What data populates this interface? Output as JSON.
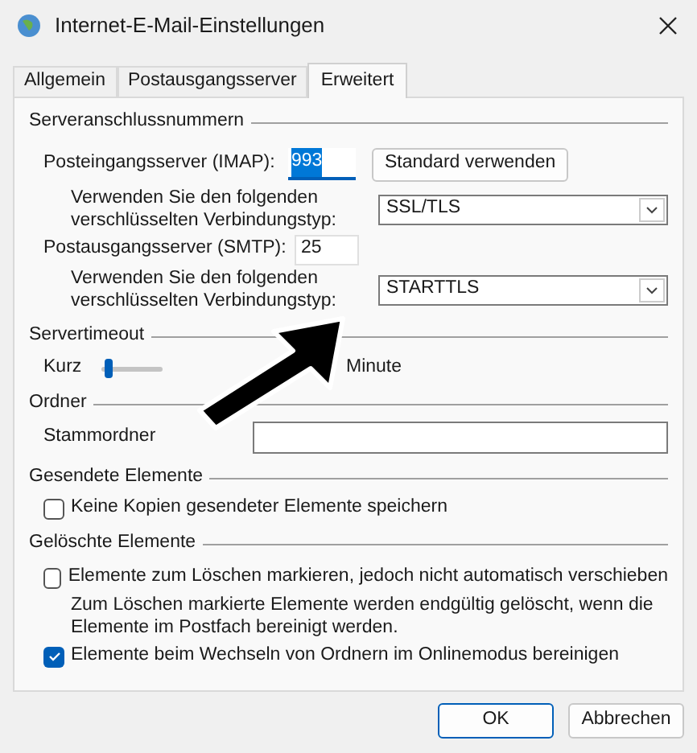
{
  "window": {
    "title": "Internet-E-Mail-Einstellungen"
  },
  "tabs": [
    {
      "label": "Allgemein",
      "selected": false
    },
    {
      "label": "Postausgangsserver",
      "selected": false
    },
    {
      "label": "Erweitert",
      "selected": true
    }
  ],
  "ports": {
    "title": "Serveranschlussnummern",
    "incoming": {
      "label": "Posteingangsserver (IMAP):",
      "value": "993",
      "selected": true,
      "button": "Standard verwenden"
    },
    "incoming_encryption": {
      "label": "Verwenden Sie den folgenden verschlüsselten Verbindungstyp:",
      "value": "SSL/TLS"
    },
    "outgoing": {
      "label": "Postausgangsserver (SMTP):",
      "value": "25",
      "selected": false
    },
    "outgoing_encryption": {
      "label": "Verwenden Sie den folgenden verschlüsselten Verbindungstyp:",
      "value": "STARTTLS"
    }
  },
  "timeout": {
    "title": "Servertimeout",
    "min_label": "Kurz",
    "level": 0.05,
    "reading": "Minute"
  },
  "folders": {
    "title": "Ordner",
    "label": "Stammordner"
  },
  "sent": {
    "title": "Gesendete Elemente",
    "options": [
      {
        "label": "Keine Kopien gesendeter Elemente speichern",
        "checked": false
      }
    ]
  },
  "deleted": {
    "title": "Gelöschte Elemente",
    "options": [
      {
        "label": "Elemente zum Löschen markieren, jedoch nicht automatisch verschieben",
        "checked": false,
        "note": "Zum Löschen markierte Elemente werden endgültig gelöscht, wenn die Elemente im Postfach bereinigt werden."
      },
      {
        "label": "Elemente beim Wechseln von Ordnern im Onlinemodus bereinigen",
        "checked": true
      }
    ]
  },
  "buttons": [
    "OK",
    "Abbrechen"
  ]
}
